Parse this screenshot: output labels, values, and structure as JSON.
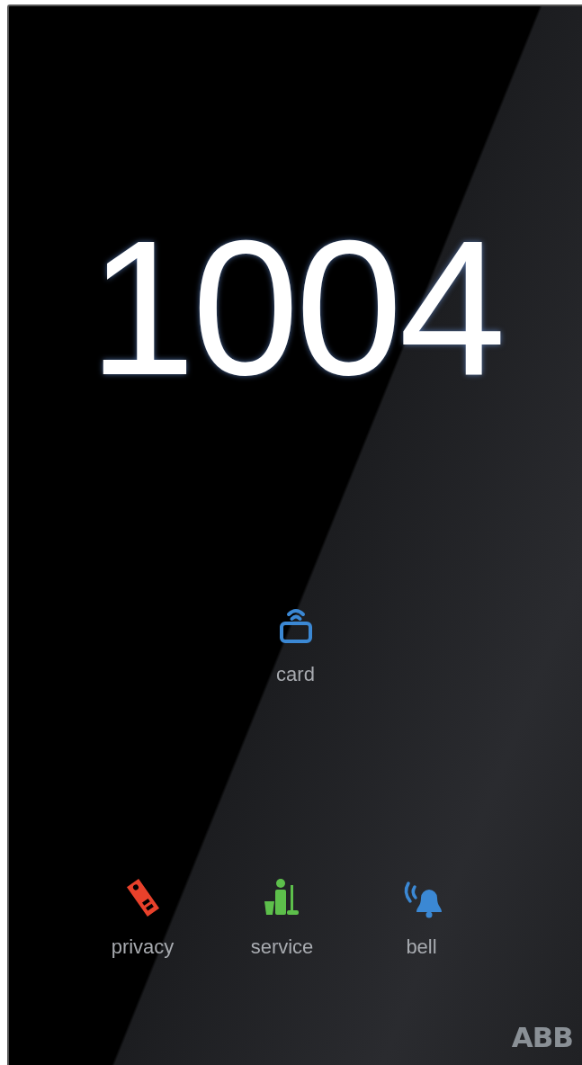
{
  "room_number": "1004",
  "card": {
    "label": "card",
    "kind": "card",
    "color": "#3b88d4"
  },
  "buttons": [
    {
      "label": "privacy",
      "kind": "privacy",
      "color": "#e8412b"
    },
    {
      "label": "service",
      "kind": "service",
      "color": "#5dbf4b"
    },
    {
      "label": "bell",
      "kind": "bell",
      "color": "#3b88d4"
    }
  ],
  "logo": "ABB"
}
